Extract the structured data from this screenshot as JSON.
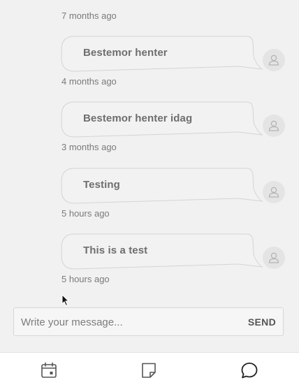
{
  "messages": [
    {
      "text": "",
      "time": "7 months ago"
    },
    {
      "text": "Bestemor henter",
      "time": "4 months ago"
    },
    {
      "text": "Bestemor henter idag",
      "time": "3 months ago"
    },
    {
      "text": "Testing",
      "time": "5 hours ago"
    },
    {
      "text": "This is a test",
      "time": "5 hours ago"
    }
  ],
  "composer": {
    "placeholder": "Write your message...",
    "send_label": "SEND"
  },
  "tabs": {
    "calendar": "calendar-icon",
    "notes": "note-icon",
    "chat": "chat-bubble-icon"
  },
  "colors": {
    "background": "#f1f1f1",
    "bubble_border": "#d4d4d4",
    "text": "#6e6e6e",
    "tabbar": "#ffffff"
  }
}
